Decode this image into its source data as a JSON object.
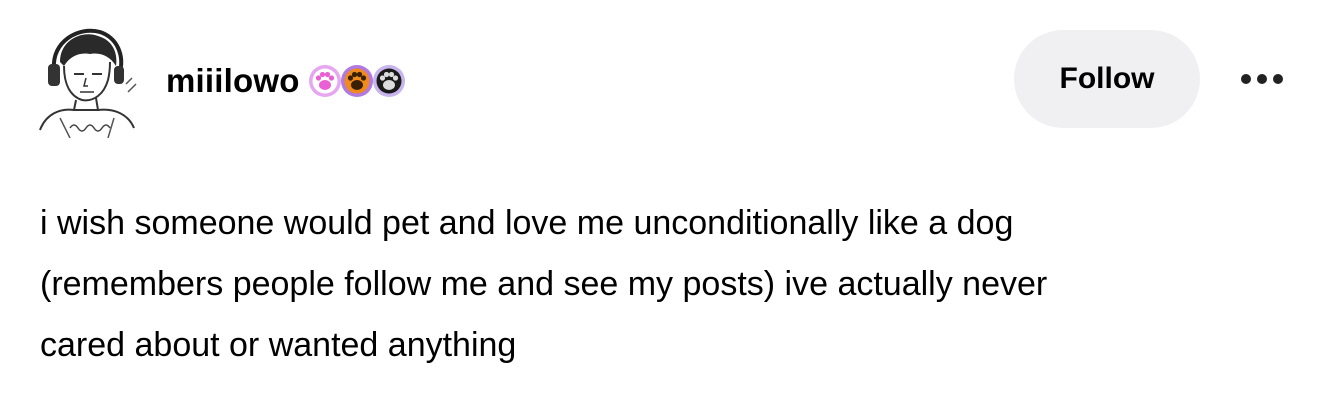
{
  "author": {
    "username": "miiilowo",
    "badges": [
      {
        "icon": "pink-paw-badge-icon",
        "color": "#e58be0"
      },
      {
        "icon": "orange-paw-badge-icon",
        "color": "#e07a1f"
      },
      {
        "icon": "black-paw-badge-icon",
        "color": "#c9b8e8"
      }
    ],
    "avatar_text": "selfportrait"
  },
  "actions": {
    "follow_label": "Follow",
    "more_icon": "ellipsis-icon"
  },
  "post": {
    "body": "i wish someone would pet and love me unconditionally like a dog\n(remembers people follow me and see my posts) ive actually never\ncared about or wanted anything"
  }
}
